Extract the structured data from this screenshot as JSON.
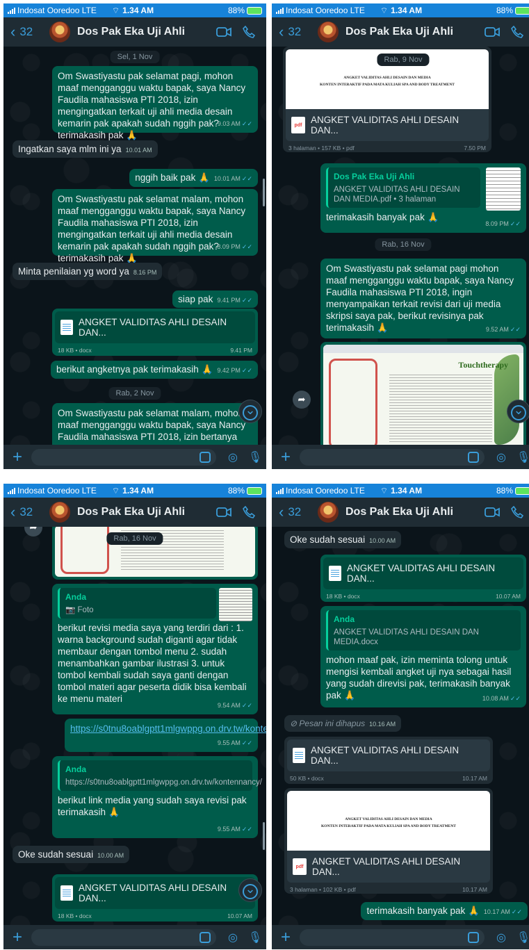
{
  "status": {
    "carrier": "Indosat Ooredoo",
    "network": "LTE",
    "time": "1.34 AM",
    "battery": "88%"
  },
  "header": {
    "back_count": "32",
    "contact": "Dos Pak Eka Uji Ahli"
  },
  "panel1": {
    "date1": "Sel, 1 Nov",
    "m1": "Om Swastiyastu pak selamat pagi, mohon maaf mengganggu waktu bapak, saya Nancy Faudila mahasiswa PTI 2018, izin mengingatkan terkait uji ahli media desain kemarin pak apakah sudah nggih pak? terimakasih pak 🙏",
    "m1_time": "9.03 AM",
    "m2": "Ingatkan saya mlm ini ya",
    "m2_time": "10.01 AM",
    "m3": "nggih baik pak 🙏",
    "m3_time": "10.01 AM",
    "m4": "Om Swastiyastu pak selamat malam, mohon maaf mengganggu waktu bapak, saya Nancy Faudila mahasiswa PTI 2018, izin mengingatkan terkait uji ahli media desain kemarin pak apakah sudah nggih pak? terimakasih pak 🙏",
    "m4_time": "8.09 PM",
    "m5": "Minta penilaian yg word ya",
    "m5_time": "8.16 PM",
    "m6": "siap pak",
    "m6_time": "9.41 PM",
    "doc_name": "ANGKET VALIDITAS AHLI DESAIN DAN...",
    "doc_info": "18 KB • docx",
    "doc_time": "9.41 PM",
    "m7": "berikut angketnya pak terimakasih 🙏",
    "m7_time": "9.42 PM",
    "date2": "Rab, 2 Nov",
    "m8": "Om Swastiyastu pak selamat malam, mohon maaf mengganggu waktu bapak, saya Nancy Faudila mahasiswa PTI 2018, izin bertanya"
  },
  "panel2": {
    "date1": "Rab, 9 Nov",
    "preview_line1": "ANGKET VALIDITAS AHLI DESAIN DAN MEDIA",
    "preview_line2": "KONTEN INTERAKTIF PADA MATA KULIAH SPA AND BODY TREATMENT",
    "pdf_name": "ANGKET VALIDITAS AHLI DESAIN DAN...",
    "pdf_info": "3 halaman • 157 KB • pdf",
    "pdf_time": "7.50 PM",
    "q_name": "Dos Pak Eka Uji Ahli",
    "q_text": "ANGKET VALIDITAS AHLI DESAIN DAN MEDIA.pdf • 3 halaman",
    "m1": "terimakasih banyak pak 🙏",
    "m1_time": "8.09 PM",
    "date2": "Rab, 16 Nov",
    "m2": "Om Swastiyastu pak selamat pagi mohon maaf mengganggu waktu bapak, saya Nancy Faudila mahasiswa PTI 2018, ingin menyampaikan terkait revisi dari uji media skripsi saya pak, berikut revisinya pak terimakasih 🙏",
    "m2_time": "9.52 AM",
    "img_title": "Touchtherapy"
  },
  "panel3": {
    "date1": "Rab, 16 Nov",
    "q1_name": "Anda",
    "q1_text": "Foto",
    "m1": "berikut revisi media saya yang terdiri dari : 1. warna background sudah diganti agar tidak membaur dengan tombol menu 2. sudah menambahkan gambar ilustrasi 3. untuk tombol kembali sudah saya ganti dengan tombol materi agar peserta didik bisa kembali ke menu materi",
    "m1_time": "9.54 AM",
    "link": "https://s0tnu8oablgptt1mlgwppg.on.drv.tw/kontennancy/",
    "link_time": "9.55 AM",
    "q2_name": "Anda",
    "q2_text": "https://s0tnu8oablgptt1mlgwppg.on.drv.tw/kontennancy/",
    "m2": "berikut link media yang sudah saya revisi pak terimakasih 🙏",
    "m2_time": "9.55 AM",
    "m3": "Oke sudah sesuai",
    "m3_time": "10.00 AM",
    "doc_name": "ANGKET VALIDITAS AHLI DESAIN DAN...",
    "doc_info": "18 KB • docx",
    "doc_time": "10.07 AM"
  },
  "panel4": {
    "m1": "Oke sudah sesuai",
    "m1_time": "10.00 AM",
    "doc_name": "ANGKET VALIDITAS AHLI DESAIN DAN...",
    "doc_info": "18 KB • docx",
    "doc_time": "10.07 AM",
    "q_name": "Anda",
    "q_text": "ANGKET VALIDITAS AHLI DESAIN DAN MEDIA.docx",
    "m2": "mohon maaf pak, izin meminta tolong untuk mengisi kembali angket uji nya sebagai hasil yang sudah direvisi pak, terimakasih banyak pak 🙏",
    "m2_time": "10.08 AM",
    "deleted": "Pesan ini dihapus",
    "deleted_time": "10.16 AM",
    "doc2_name": "ANGKET VALIDITAS AHLI DESAIN DAN...",
    "doc2_info": "50 KB • docx",
    "doc2_time": "10.17 AM",
    "preview_line1": "ANGKET VALIDITAS AHLI DESAIN DAN MEDIA",
    "preview_line2": "KONTEN INTERAKTIF PADA MATA KULIAH SPA AND BODY TREATMENT",
    "pdf_name": "ANGKET VALIDITAS AHLI DESAIN DAN...",
    "pdf_info": "3 halaman • 102 KB • pdf",
    "pdf_time": "10.17 AM",
    "m3": "terimakasih banyak pak 🙏",
    "m3_time": "10.17 AM"
  },
  "colors": {
    "status_bar": "#1783d9",
    "header": "#1f2c34",
    "outgoing": "#005c4b",
    "incoming": "#202c33",
    "accent": "#3a9dd9",
    "read_tick": "#53bdeb"
  },
  "icons": [
    "signal-icon",
    "wifi-icon",
    "battery-icon",
    "back-chevron-icon",
    "video-call-icon",
    "phone-icon",
    "plus-icon",
    "sticker-icon",
    "camera-icon",
    "mic-icon",
    "doc-icon",
    "pdf-icon",
    "scroll-down-icon",
    "forward-icon",
    "deleted-icon",
    "photo-icon"
  ]
}
